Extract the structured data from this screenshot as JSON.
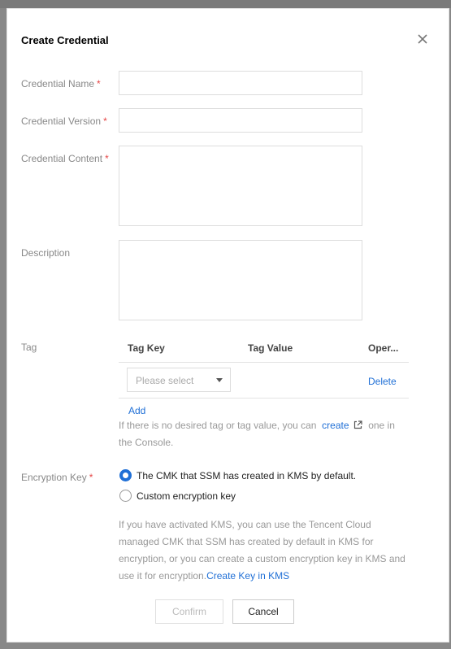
{
  "dialog": {
    "title": "Create Credential"
  },
  "form": {
    "name_label": "Credential Name",
    "version_label": "Credential Version",
    "content_label": "Credential Content",
    "description_label": "Description",
    "tag_label": "Tag",
    "encryption_label": "Encryption Key",
    "required_mark": "*"
  },
  "tags": {
    "col_key": "Tag Key",
    "col_value": "Tag Value",
    "col_op": "Oper...",
    "select_placeholder": "Please select",
    "delete_label": "Delete",
    "add_label": "Add",
    "hint_prefix": "If there is no desired tag or tag value, you can",
    "hint_link": "create",
    "hint_suffix": "one in",
    "hint_line2": "the Console."
  },
  "encryption": {
    "option_default": "The CMK that SSM has created in KMS by default.",
    "option_custom": "Custom encryption key",
    "note_line1": "If you have activated KMS, you can use the Tencent Cloud",
    "note_line2": "managed CMK that SSM has created by default in KMS for",
    "note_line3": "encryption, or you can create a custom encryption key in KMS and",
    "note_line4": "use it for encryption.",
    "note_link": "Create Key in KMS",
    "selected": "default"
  },
  "footer": {
    "confirm_label": "Confirm",
    "cancel_label": "Cancel"
  },
  "colors": {
    "accent": "#1f6fd6",
    "required": "#e54545"
  }
}
